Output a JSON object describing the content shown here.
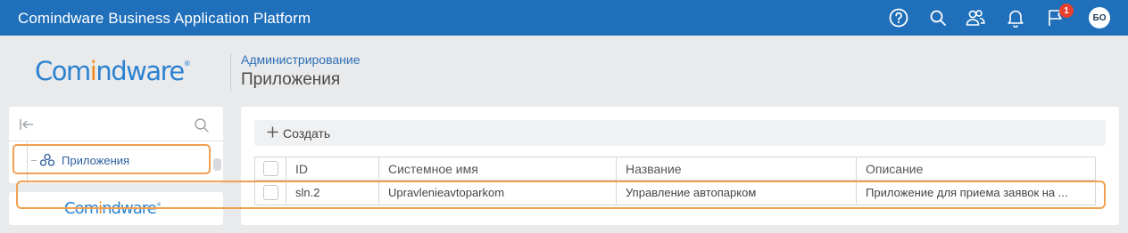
{
  "topbar": {
    "app_title": "Comindware Business Application Platform",
    "background_color": "#1f6fba",
    "icons": [
      "help-icon",
      "search-icon",
      "users-icon",
      "bell-icon",
      "flag-icon"
    ],
    "notification_count": "1",
    "avatar_initials": "БО"
  },
  "brand": {
    "logo_prefix": "Com",
    "logo_accent": "i",
    "logo_suffix": "ndware",
    "logo_mark": "®",
    "primary_color": "#2c82d0",
    "accent_color": "#f08a1c"
  },
  "header": {
    "breadcrumb": "Администрирование",
    "page_title": "Приложения"
  },
  "nav": {
    "items": [
      {
        "label": "Приложения",
        "icon": "apps-icon",
        "highlighted": true
      }
    ],
    "highlight_color": "#f0a050"
  },
  "toolbar": {
    "create_label": "Создать"
  },
  "table": {
    "columns": [
      "ID",
      "Системное имя",
      "Название",
      "Описание"
    ],
    "rows": [
      {
        "id": "sln.2",
        "system_name": "Upravlenieavtoparkom",
        "name": "Управление автопарком",
        "description": "Приложение для приема заявок на ..."
      }
    ]
  }
}
